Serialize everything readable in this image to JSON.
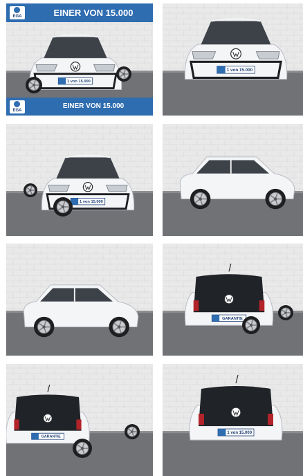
{
  "gallery": {
    "banner_text_top": "EINER VON 15.000",
    "banner_text_bottom": "EINER VON 15.000",
    "ega_logo_text": "EGA",
    "plate_front_1": "1 von 15.000",
    "plate_front_2": "1 von 15.000",
    "plate_rear": "GARANTIE",
    "plate_rear_2": "1 von 15.000",
    "accent_color": "#2f6db1",
    "photos": [
      {
        "name": "photo-front-left-promo"
      },
      {
        "name": "photo-front"
      },
      {
        "name": "photo-front-left"
      },
      {
        "name": "photo-front-right"
      },
      {
        "name": "photo-side"
      },
      {
        "name": "photo-rear-right"
      },
      {
        "name": "photo-rear-left"
      },
      {
        "name": "photo-rear"
      }
    ]
  }
}
